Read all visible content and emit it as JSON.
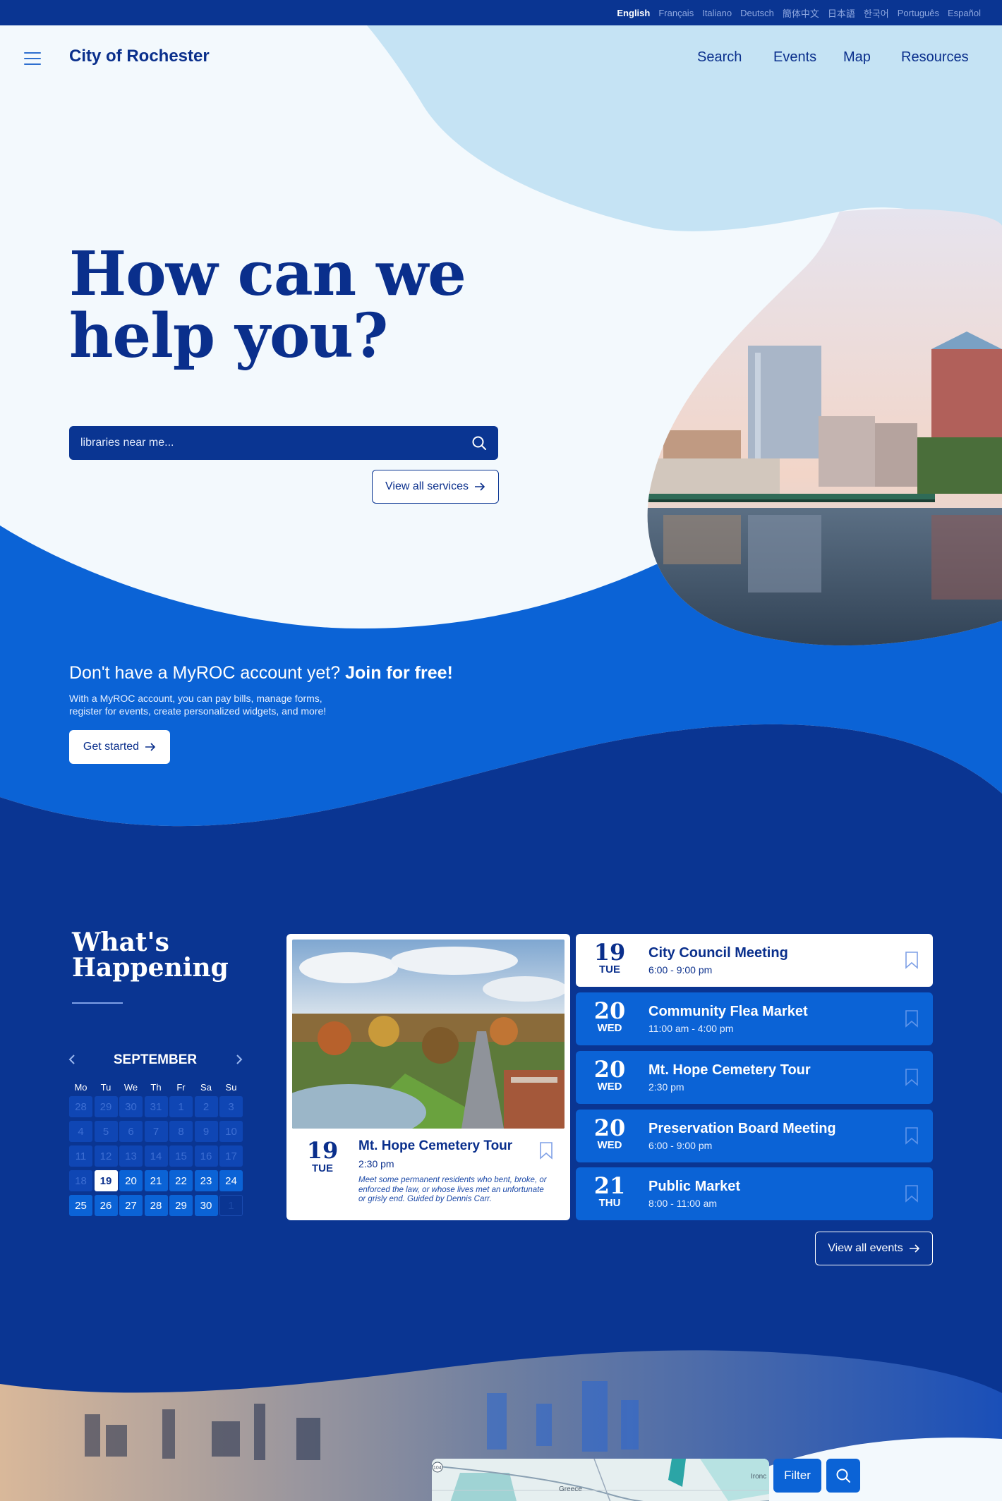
{
  "languages": [
    {
      "label": "English",
      "active": true
    },
    {
      "label": "Français"
    },
    {
      "label": "Italiano"
    },
    {
      "label": "Deutsch"
    },
    {
      "label": "簡体中文"
    },
    {
      "label": "日本語"
    },
    {
      "label": "한국어"
    },
    {
      "label": "Português"
    },
    {
      "label": "Español"
    }
  ],
  "header": {
    "brand": "City of Rochester",
    "nav": [
      "Search",
      "Events",
      "Map",
      "Resources"
    ]
  },
  "hero": {
    "title_line1": "How can we",
    "title_line2": "help you?",
    "search_placeholder": "libraries near me...",
    "view_services": "View all services"
  },
  "join": {
    "prompt": "Don't have a MyROC account yet?",
    "cta": "Join for free!",
    "description_line1": "With a MyROC account, you can pay bills, manage forms,",
    "description_line2": "register for events, create personalized widgets, and more!",
    "button": "Get started"
  },
  "whats_happening": {
    "title_line1": "What's",
    "title_line2": "Happening"
  },
  "calendar": {
    "month": "SEPTEMBER",
    "weekdays": [
      "Mo",
      "Tu",
      "We",
      "Th",
      "Fr",
      "Sa",
      "Su"
    ],
    "days": [
      {
        "n": "28",
        "s": "prev"
      },
      {
        "n": "29",
        "s": "prev"
      },
      {
        "n": "30",
        "s": "prev"
      },
      {
        "n": "31",
        "s": "prev"
      },
      {
        "n": "1",
        "s": "past"
      },
      {
        "n": "2",
        "s": "past"
      },
      {
        "n": "3",
        "s": "past"
      },
      {
        "n": "4",
        "s": "past"
      },
      {
        "n": "5",
        "s": "past"
      },
      {
        "n": "6",
        "s": "past"
      },
      {
        "n": "7",
        "s": "past"
      },
      {
        "n": "8",
        "s": "past"
      },
      {
        "n": "9",
        "s": "past"
      },
      {
        "n": "10",
        "s": "past"
      },
      {
        "n": "11",
        "s": "past"
      },
      {
        "n": "12",
        "s": "past"
      },
      {
        "n": "13",
        "s": "past"
      },
      {
        "n": "14",
        "s": "past"
      },
      {
        "n": "15",
        "s": "past"
      },
      {
        "n": "16",
        "s": "past"
      },
      {
        "n": "17",
        "s": "past"
      },
      {
        "n": "18",
        "s": "past"
      },
      {
        "n": "19",
        "s": "today"
      },
      {
        "n": "20",
        "s": "cur"
      },
      {
        "n": "21",
        "s": "cur"
      },
      {
        "n": "22",
        "s": "cur"
      },
      {
        "n": "23",
        "s": "cur"
      },
      {
        "n": "24",
        "s": "cur"
      },
      {
        "n": "25",
        "s": "cur"
      },
      {
        "n": "26",
        "s": "cur"
      },
      {
        "n": "27",
        "s": "cur"
      },
      {
        "n": "28",
        "s": "cur"
      },
      {
        "n": "29",
        "s": "cur"
      },
      {
        "n": "30",
        "s": "cur"
      },
      {
        "n": "1",
        "s": "next"
      }
    ]
  },
  "featured_event": {
    "day": "19",
    "dow": "TUE",
    "title": "Mt. Hope Cemetery Tour",
    "time": "2:30 pm",
    "description": "Meet some permanent residents who bent, broke, or enforced the law, or whose lives met an unfortunate or grisly end. Guided by Dennis Carr."
  },
  "events": [
    {
      "day": "19",
      "dow": "TUE",
      "title": "City Council Meeting",
      "time": "6:00 - 9:00 pm"
    },
    {
      "day": "20",
      "dow": "WED",
      "title": "Community Flea Market",
      "time": "11:00 am - 4:00 pm"
    },
    {
      "day": "20",
      "dow": "WED",
      "title": "Mt. Hope Cemetery Tour",
      "time": "2:30 pm"
    },
    {
      "day": "20",
      "dow": "WED",
      "title": "Preservation Board Meeting",
      "time": "6:00 - 9:00 pm"
    },
    {
      "day": "21",
      "dow": "THU",
      "title": "Public Market",
      "time": "8:00 - 11:00 am"
    }
  ],
  "view_events": "View all events",
  "map": {
    "filter": "Filter",
    "labels": [
      "Greece",
      "Ironc"
    ],
    "route": "104"
  },
  "colors": {
    "navy": "#0a3592",
    "blue": "#0b63d6",
    "sky": "#c5e3f4",
    "paper": "#f3f9fd"
  },
  "icons": [
    "hamburger-icon",
    "search-icon",
    "arrow-right-icon",
    "chevron-left-icon",
    "chevron-right-icon",
    "bookmark-icon"
  ]
}
